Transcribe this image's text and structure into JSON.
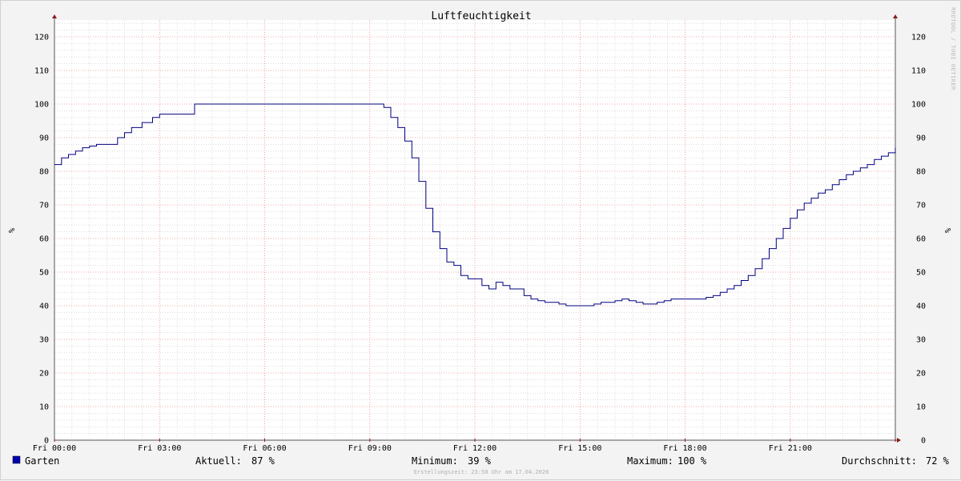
{
  "chart_data": {
    "type": "line",
    "title": "Luftfeuchtigkeit",
    "ylabel": "%",
    "ylim": [
      0,
      125
    ],
    "yticks": [
      0,
      10,
      20,
      30,
      40,
      50,
      60,
      70,
      80,
      90,
      100,
      110,
      120
    ],
    "xlim": [
      0,
      24
    ],
    "xtick_labels": [
      "Fri 00:00",
      "Fri 03:00",
      "Fri 06:00",
      "Fri 09:00",
      "Fri 12:00",
      "Fri 15:00",
      "Fri 18:00",
      "Fri 21:00"
    ],
    "grid": true,
    "series": [
      {
        "name": "Garten",
        "color": "#000080",
        "x_hours": [
          0,
          0.2,
          0.4,
          0.6,
          0.8,
          1.0,
          1.2,
          1.5,
          1.8,
          2.0,
          2.2,
          2.5,
          2.8,
          3.0,
          4.0,
          5.0,
          6.0,
          7.0,
          8.0,
          9.0,
          9.4,
          9.6,
          9.8,
          10.0,
          10.2,
          10.4,
          10.6,
          10.8,
          11.0,
          11.2,
          11.4,
          11.6,
          11.8,
          12.0,
          12.2,
          12.4,
          12.6,
          12.8,
          13.0,
          13.2,
          13.4,
          13.6,
          13.8,
          14.0,
          14.2,
          14.4,
          14.6,
          14.8,
          15.0,
          15.2,
          15.4,
          15.6,
          15.8,
          16.0,
          16.2,
          16.4,
          16.6,
          16.8,
          17.0,
          17.2,
          17.4,
          17.6,
          17.8,
          18.0,
          18.2,
          18.4,
          18.6,
          18.8,
          19.0,
          19.2,
          19.4,
          19.6,
          19.8,
          20.0,
          20.2,
          20.4,
          20.6,
          20.8,
          21.0,
          21.2,
          21.4,
          21.6,
          21.8,
          22.0,
          22.2,
          22.4,
          22.6,
          22.8,
          23.0,
          23.2,
          23.4,
          23.6,
          23.8,
          24.0
        ],
        "values": [
          82,
          84,
          85,
          86,
          87,
          87.5,
          88,
          88,
          90,
          91.5,
          93,
          94.5,
          96,
          97,
          100,
          100,
          100,
          100,
          100,
          100,
          99,
          96,
          93,
          89,
          84,
          77,
          69,
          62,
          57,
          53,
          52,
          49,
          48,
          48,
          46,
          45,
          47,
          46,
          45,
          45,
          43,
          42,
          41.5,
          41,
          41,
          40.5,
          40,
          40,
          40,
          40,
          40.5,
          41,
          41,
          41.5,
          42,
          41.5,
          41,
          40.5,
          40.5,
          41,
          41.5,
          42,
          42,
          42,
          42,
          42,
          42.5,
          43,
          44,
          45,
          46,
          47.5,
          49,
          51,
          54,
          57,
          60,
          63,
          66,
          68.5,
          70.5,
          72,
          73.5,
          74.5,
          76,
          77.5,
          79,
          80,
          81,
          82,
          83.5,
          84.5,
          85.5,
          87
        ]
      }
    ]
  },
  "legend": {
    "series_name": "Garten",
    "current_label": "Aktuell:",
    "current_value": "87 %",
    "min_label": "Minimum:",
    "min_value": "39 %",
    "max_label": "Maximum:",
    "max_value": "100 %",
    "avg_label": "Durchschnitt:",
    "avg_value": "72 %"
  },
  "footer": "Erstellungszeit: 23:58 Uhr am 17.04.2026",
  "watermark": "RRDTOOL / TOBI OETIKER",
  "colors": {
    "line": "#000080",
    "legend_swatch": "#0000b0",
    "major_grid": "#f08c8c",
    "minor_grid": "#c8c8c8",
    "axis": "#555555",
    "arrow": "#8b1a1a",
    "plot_bg": "#ffffff",
    "canvas_bg": "#f3f3f3"
  }
}
